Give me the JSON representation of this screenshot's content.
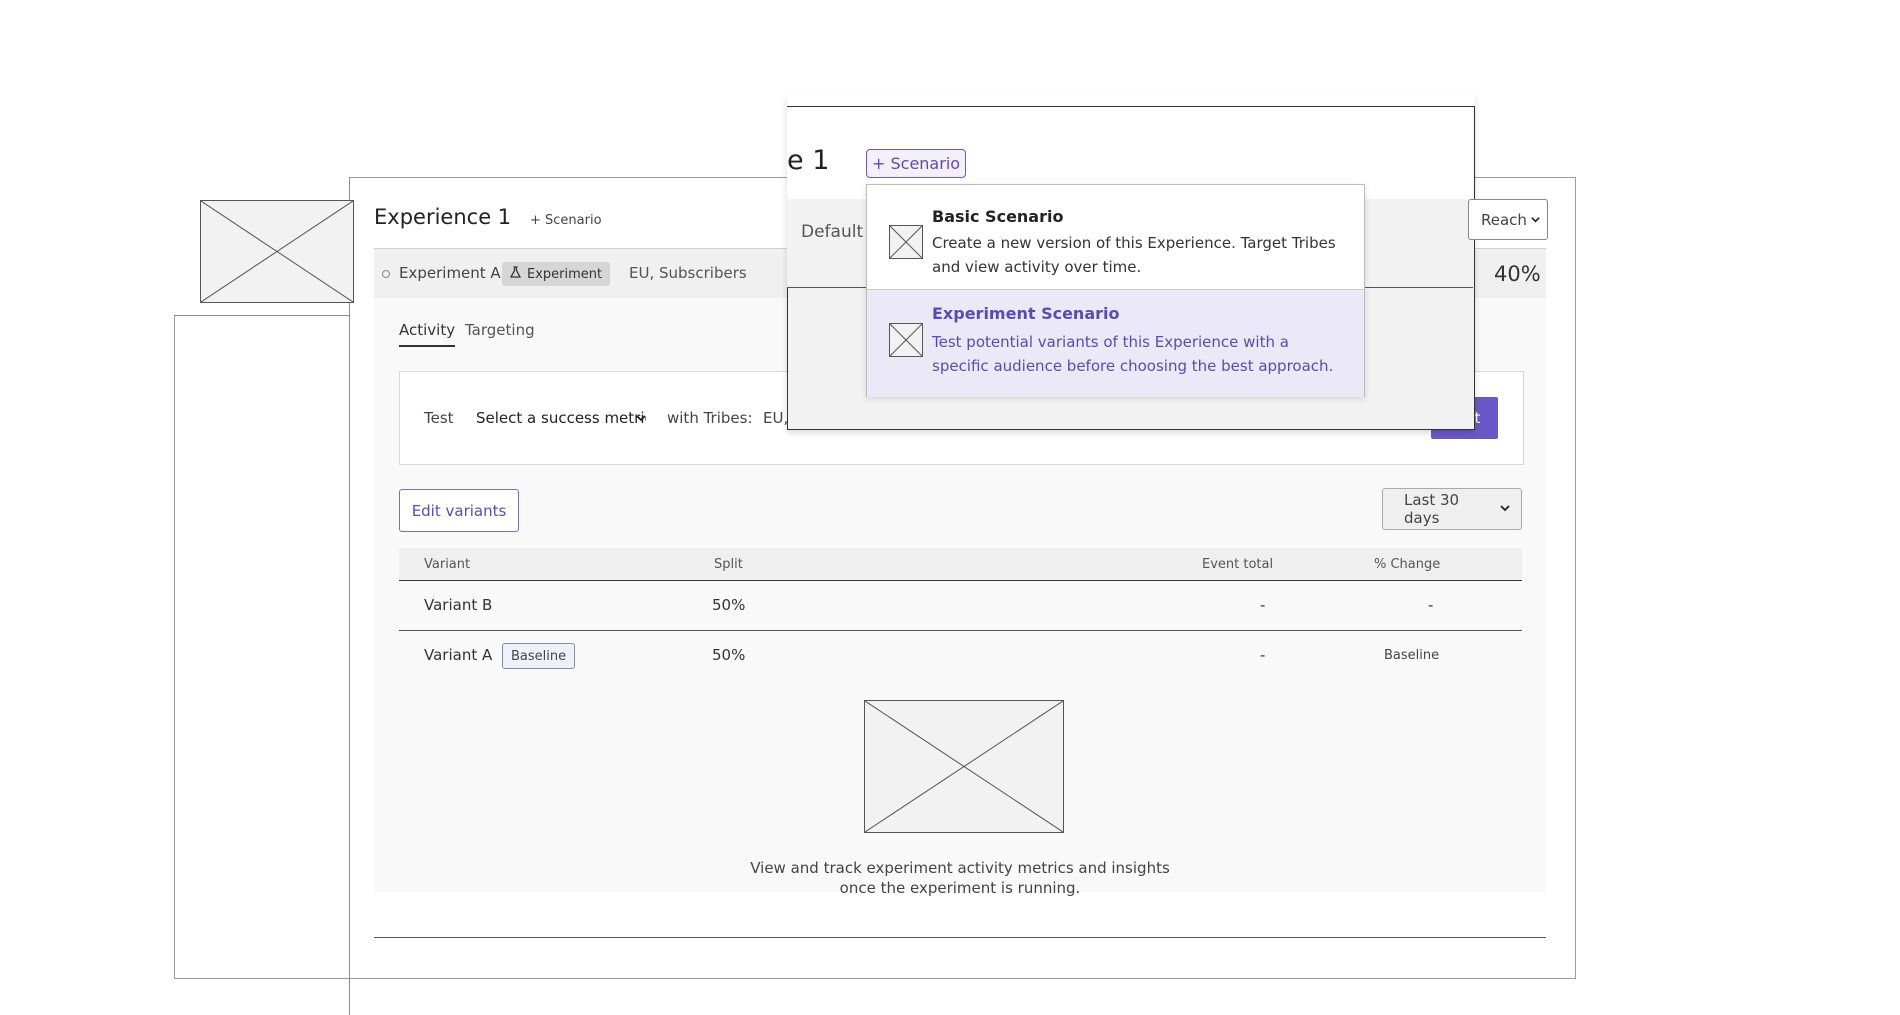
{
  "experience": {
    "title": "Experience 1",
    "add_scenario_label": "+ Scenario",
    "row": {
      "name": "Experiment A",
      "badge": "Experiment",
      "tribes": "EU, Subscribers",
      "reach_percent": "40%"
    }
  },
  "tabs": [
    {
      "label": "Activity",
      "active": true
    },
    {
      "label": "Targeting",
      "active": false
    }
  ],
  "metric_bar": {
    "test_label": "Test",
    "metric_select": "Select a success metric",
    "with_tribes_label": "with Tribes:",
    "tribes_value": "EU,",
    "start_button": "t"
  },
  "toolbar": {
    "edit_variants_label": "Edit variants",
    "date_range": "Last 30 days"
  },
  "table": {
    "columns": [
      "Variant",
      "Split",
      "Event total",
      "% Change"
    ],
    "rows": [
      {
        "variant": "Variant B",
        "badge": "",
        "split": "50%",
        "event_total": "-",
        "change": "-"
      },
      {
        "variant": "Variant A",
        "badge": "Baseline",
        "split": "50%",
        "event_total": "-",
        "change": "Baseline"
      }
    ]
  },
  "empty_state": {
    "message": "View and track experiment activity metrics and insights once the experiment is running."
  },
  "popup": {
    "title_fragment": "e 1",
    "scenario_button": "+ Scenario",
    "default_label": "Default",
    "right_select": "Reach"
  },
  "scenario_menu": {
    "items": [
      {
        "title": "Basic Scenario",
        "description": "Create a new version of this Experience. Target Tribes and view activity over time."
      },
      {
        "title": "Experiment Scenario",
        "description": "Test potential variants of this Experience with a specific audience before choosing the best approach."
      }
    ]
  },
  "colors": {
    "accent": "#6b58c8",
    "accent_text": "#5b4bb0",
    "highlight": "#ebe8f8"
  },
  "icons": {
    "row_status": "circle-icon",
    "experiment": "flask-icon",
    "placeholder": "image-placeholder-icon",
    "dropdown": "chevron-down-icon"
  }
}
